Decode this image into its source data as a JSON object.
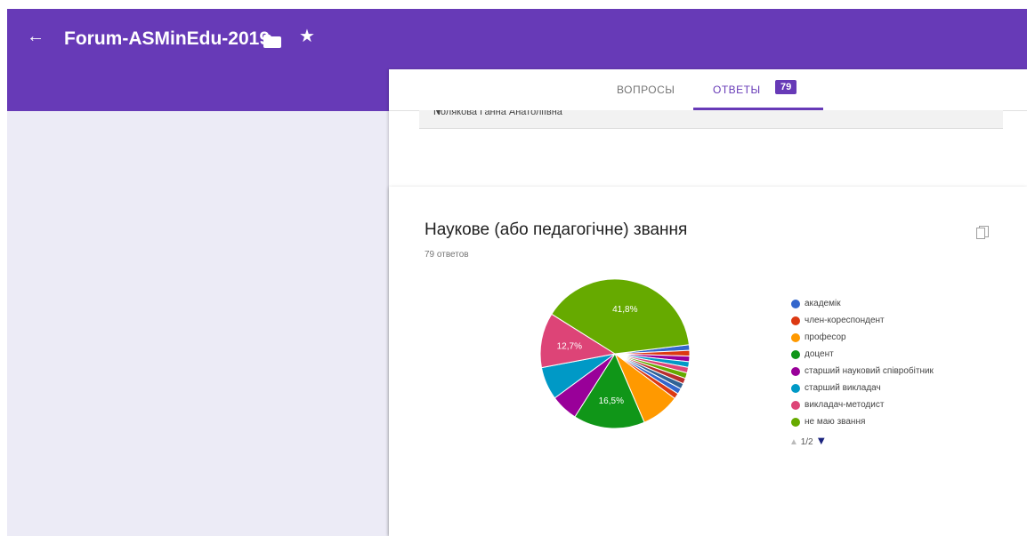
{
  "header": {
    "back_icon": "arrow-left-icon",
    "title": "Forum-ASMinEdu-2019",
    "folder_icon": "folder-icon",
    "star_icon": "star-icon",
    "color": "#673ab7"
  },
  "tabs": {
    "questions": "ВОПРОСЫ",
    "responses": "ОТВЕТЫ",
    "responses_count": "79"
  },
  "respondent_select": {
    "value": "Полякова Ганна Анатоліївна"
  },
  "question": {
    "title": "Наукове (або педагогічне) звання",
    "subtitle": "79 ответов",
    "copy_icon": "copy-icon"
  },
  "pager": {
    "text": "1/2"
  },
  "chart_data": {
    "type": "pie",
    "labels": [
      "академік",
      "член-кореспондент",
      "професор",
      "доцент",
      "старший науковий співробітник",
      "старший викладач",
      "викладач-методист",
      "не маю звання"
    ],
    "legend_page": "1/2",
    "slices": [
      {
        "label": "",
        "value": 1.3,
        "color": "#3366cc",
        "text": ""
      },
      {
        "label": "",
        "value": 1.3,
        "color": "#dc3912",
        "text": ""
      },
      {
        "label": "",
        "value": 1.3,
        "color": "#990099",
        "text": ""
      },
      {
        "label": "",
        "value": 1.3,
        "color": "#0099c6",
        "text": ""
      },
      {
        "label": "",
        "value": 1.3,
        "color": "#dd4477",
        "text": ""
      },
      {
        "label": "",
        "value": 1.3,
        "color": "#66aa00",
        "text": ""
      },
      {
        "label": "",
        "value": 1.3,
        "color": "#b82e2e",
        "text": ""
      },
      {
        "label": "",
        "value": 1.3,
        "color": "#316395",
        "text": ""
      },
      {
        "label": "академік",
        "value": 1.3,
        "color": "#3366cc",
        "text": ""
      },
      {
        "label": "член-кореспондент",
        "value": 1.3,
        "color": "#dc3912",
        "text": ""
      },
      {
        "label": "професор",
        "value": 8.9,
        "color": "#ff9900",
        "text": ""
      },
      {
        "label": "доцент",
        "value": 16.5,
        "color": "#109618",
        "text": "16,5%"
      },
      {
        "label": "старший науковий співробітник",
        "value": 6.3,
        "color": "#990099",
        "text": ""
      },
      {
        "label": "старший викладач",
        "value": 7.6,
        "color": "#0099c6",
        "text": ""
      },
      {
        "label": "викладач-методист",
        "value": 12.7,
        "color": "#dd4477",
        "text": "12,7%"
      },
      {
        "label": "не маю звання",
        "value": 41.8,
        "color": "#66aa00",
        "text": "41,8%"
      }
    ],
    "legend": [
      {
        "label": "академік",
        "color": "#3366cc"
      },
      {
        "label": "член-кореспондент",
        "color": "#dc3912"
      },
      {
        "label": "професор",
        "color": "#ff9900"
      },
      {
        "label": "доцент",
        "color": "#109618"
      },
      {
        "label": "старший науковий співробітник",
        "color": "#990099"
      },
      {
        "label": "старший викладач",
        "color": "#0099c6"
      },
      {
        "label": "викладач-методист",
        "color": "#dd4477"
      },
      {
        "label": "не маю звання",
        "color": "#66aa00"
      }
    ]
  }
}
